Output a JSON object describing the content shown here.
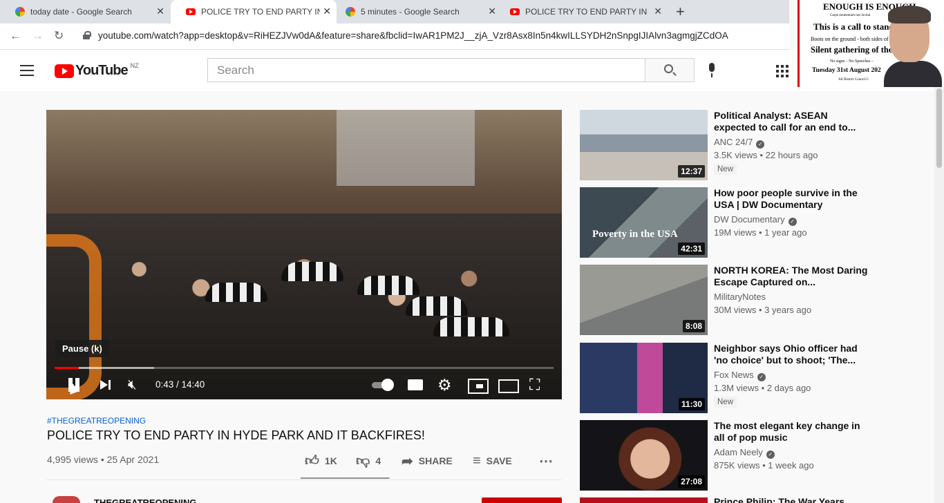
{
  "browser": {
    "tabs": [
      {
        "label": "today date - Google Search",
        "favicon": "google-icon",
        "active": false
      },
      {
        "label": "POLICE TRY TO END PARTY IN H",
        "favicon": "youtube-icon",
        "active": true
      },
      {
        "label": "5 minutes - Google Search",
        "favicon": "google-icon",
        "active": false
      },
      {
        "label": "POLICE TRY TO END PARTY IN H",
        "favicon": "youtube-icon",
        "active": false
      }
    ],
    "url": "youtube.com/watch?app=desktop&v=RiHEZJVw0dA&feature=share&fbclid=IwAR1PM2J__zjA_Vzr8Asx8In5n4kwILLSYDH2nSnpgIJIAlvn3agmgjZCdOA"
  },
  "overlay": {
    "lines": [
      "ENOUGH IS ENOUGH",
      "Carpe momentum nos invitat",
      "This is a call to stand A",
      "Boots on the ground - both sides of",
      "Silent gathering of the m",
      "No signs – No Speeches –",
      "Tuesday 31st August 202",
      "All District Council C"
    ]
  },
  "youtube": {
    "logo_text": "YouTube",
    "region": "NZ",
    "search_placeholder": "Search"
  },
  "player": {
    "tooltip": "Pause (k)",
    "time": "0:43 / 14:40",
    "played_fraction": 0.049,
    "loaded_fraction": 0.2
  },
  "video": {
    "hashtag": "#THEGREATREOPENING",
    "title": "POLICE TRY TO END PARTY IN HYDE PARK AND IT BACKFIRES!",
    "meta": "4,995 views • 25 Apr 2021",
    "likes": "1K",
    "dislikes": "4",
    "like_ratio": 0.996,
    "share_label": "SHARE",
    "save_label": "SAVE",
    "channel_stub": "THEGREATREOPENING"
  },
  "recommendations": [
    {
      "title": "Political Analyst: ASEAN expected to call for an end to...",
      "channel": "ANC 24/7",
      "verified": true,
      "views": "3.5K views • 22 hours ago",
      "duration": "12:37",
      "badge": "New"
    },
    {
      "title": "How poor people survive in the USA | DW Documentary",
      "channel": "DW Documentary",
      "verified": true,
      "views": "19M views • 1 year ago",
      "duration": "42:31",
      "badge": "",
      "thumb_text": "Poverty in the USA"
    },
    {
      "title": "NORTH KOREA: The Most Daring Escape Captured on...",
      "channel": "MilitaryNotes",
      "verified": false,
      "views": "30M views • 3 years ago",
      "duration": "8:08",
      "badge": ""
    },
    {
      "title": "Neighbor says Ohio officer had 'no choice' but to shoot; 'The...",
      "channel": "Fox News",
      "verified": true,
      "views": "1.3M views • 2 days ago",
      "duration": "11:30",
      "badge": "New"
    },
    {
      "title": "The most elegant key change in all of pop music",
      "channel": "Adam Neely",
      "verified": true,
      "views": "875K views • 1 week ago",
      "duration": "27:08",
      "badge": ""
    }
  ],
  "last_rec_stub": "Prince Philip: The War Years"
}
